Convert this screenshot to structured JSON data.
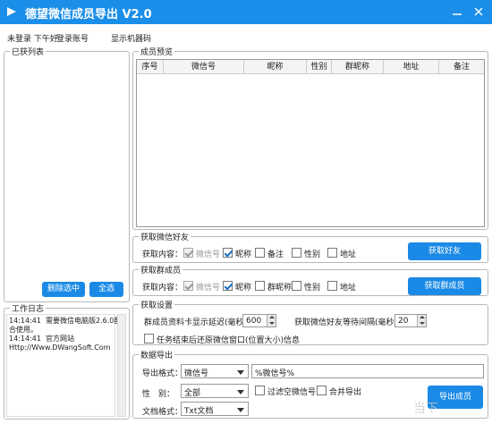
{
  "window": {
    "title": "德望微信成员导出 V2.0"
  },
  "menu": {
    "status": "未登录 下午好",
    "login": "登录账号",
    "show_machine_code": "显示机器码"
  },
  "acquired_list": {
    "title": "已获列表",
    "delete_selected": "删除选中",
    "select_all": "全选"
  },
  "work_log": {
    "title": "工作日志",
    "lines": [
      "14:14:41  需要微信电脑版2.6.0配",
      "合使用。",
      "14:14:41  官方网站",
      "Http://Www.DWangSoft.Com"
    ]
  },
  "member_preview": {
    "title": "成员预览",
    "columns": [
      "序号",
      "微信号",
      "昵称",
      "性别",
      "群昵称",
      "地址",
      "备注"
    ]
  },
  "get_friends": {
    "title": "获取微信好友",
    "content_label": "获取内容：",
    "options": [
      "微信号",
      "昵称",
      "备注",
      "性别",
      "地址"
    ],
    "button": "获取好友"
  },
  "get_group_members": {
    "title": "获取群成员",
    "content_label": "获取内容：",
    "options": [
      "微信号",
      "昵称",
      "群昵称",
      "性别",
      "地址"
    ],
    "button": "获取群成员"
  },
  "settings": {
    "title": "获取设置",
    "delay_label": "群成员资料卡显示延迟(毫秒)：",
    "delay_value": "600",
    "wait_label": "获取微信好友等待间隔(毫秒)：",
    "wait_value": "20",
    "restore_label": "任务结束后还原微信窗口(位置大小)信息"
  },
  "export": {
    "title": "数据导出",
    "format_label": "导出格式：",
    "format_value": "微信号",
    "format_text": "%微信号%",
    "gender_label": "性　别：",
    "gender_value": "全部",
    "filter_empty": "过滤空微信号",
    "merge_export": "合并导出",
    "doc_label": "文档格式：",
    "doc_value": "Txt文档",
    "button": "导出成员"
  },
  "watermark": "当下",
  "colors": {
    "titlebar": "#1a8ee8",
    "button": "#1b8ae6"
  }
}
